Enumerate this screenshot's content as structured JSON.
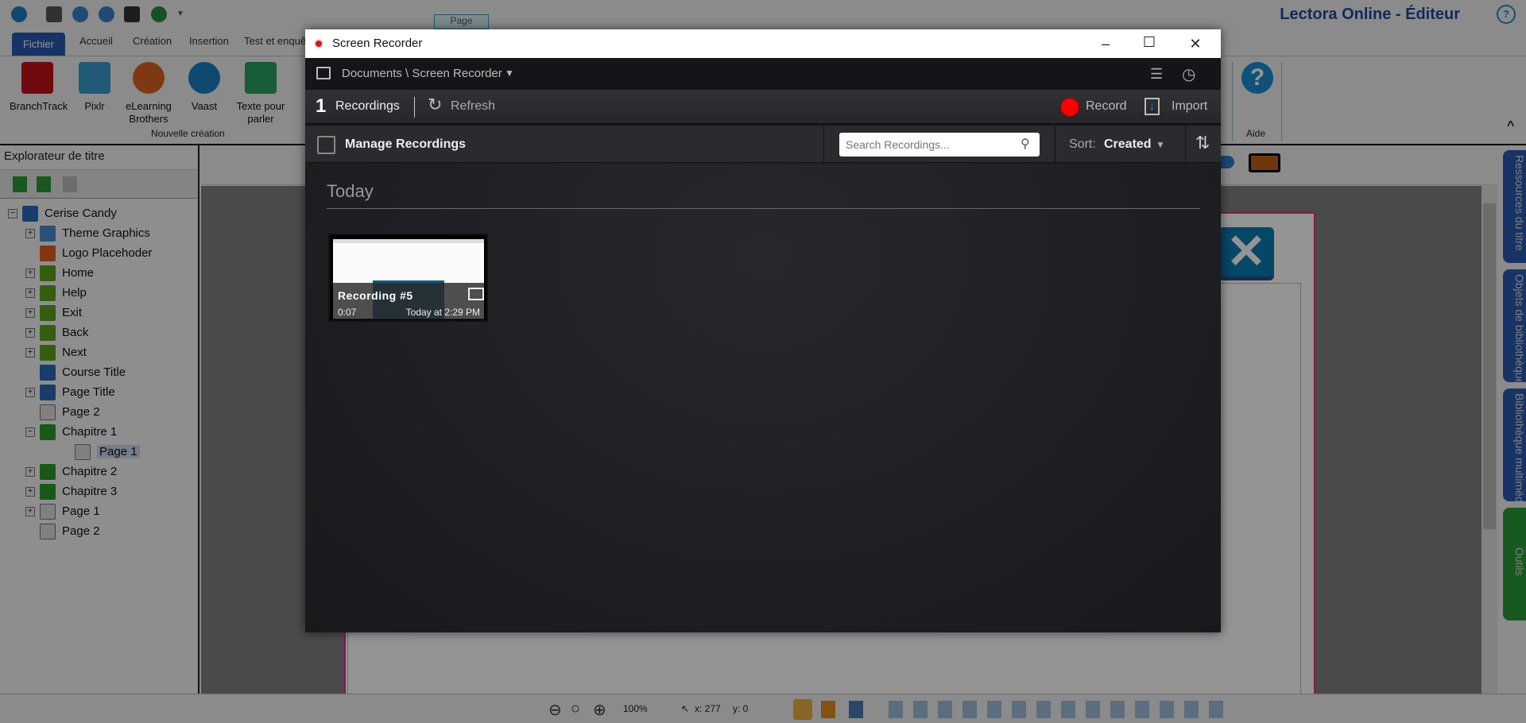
{
  "app": {
    "title": "Lectora Online - Éditeur",
    "page_button": "Page",
    "tabs": [
      "Fichier",
      "Accueil",
      "Création",
      "Insertion",
      "Test et enquê"
    ],
    "ribbon": {
      "items": [
        "BranchTrack",
        "Pixlr",
        "eLearning Brothers",
        "Vaast",
        "Texte pour parler"
      ],
      "group": "Nouvelle création",
      "help_group": "Aide"
    },
    "explorer": {
      "title": "Explorateur de titre",
      "tree": [
        {
          "label": "Cerise Candy",
          "icon": "book-icon",
          "level": 0,
          "exp": "-"
        },
        {
          "label": "Theme Graphics",
          "icon": "group-icon",
          "level": 1,
          "exp": "+"
        },
        {
          "label": "Logo Placehoder",
          "icon": "image-icon",
          "level": 1,
          "exp": ""
        },
        {
          "label": "Home",
          "icon": "button-icon",
          "level": 1,
          "exp": "+"
        },
        {
          "label": "Help",
          "icon": "button-icon",
          "level": 1,
          "exp": "+"
        },
        {
          "label": "Exit",
          "icon": "button-icon",
          "level": 1,
          "exp": "+"
        },
        {
          "label": "Back",
          "icon": "button-icon",
          "level": 1,
          "exp": "+"
        },
        {
          "label": "Next",
          "icon": "button-icon",
          "level": 1,
          "exp": "+"
        },
        {
          "label": "Course Title",
          "icon": "text-icon",
          "level": 1,
          "exp": ""
        },
        {
          "label": "Page Title",
          "icon": "text-icon",
          "level": 1,
          "exp": "+"
        },
        {
          "label": "Page 2",
          "icon": "page-icon",
          "level": 1,
          "exp": ""
        },
        {
          "label": "Chapitre 1",
          "icon": "chapter-icon",
          "level": 1,
          "exp": "-"
        },
        {
          "label": "Page 1",
          "icon": "page-icon",
          "level": 2,
          "exp": "",
          "selected": true
        },
        {
          "label": "Chapitre 2",
          "icon": "chapter-icon",
          "level": 1,
          "exp": "+"
        },
        {
          "label": "Chapitre 3",
          "icon": "chapter-icon",
          "level": 1,
          "exp": "+"
        },
        {
          "label": "Page 1",
          "icon": "page-icon",
          "level": 1,
          "exp": "+"
        },
        {
          "label": "Page 2",
          "icon": "page-icon",
          "level": 1,
          "exp": ""
        }
      ]
    },
    "side_tabs": [
      "Ressources du titre",
      "Objets de bibliothèque",
      "Bibliothèque multimédia",
      "Outils"
    ],
    "status": {
      "zoom": "100%",
      "x": "x: 277",
      "y": "y: 0"
    }
  },
  "recorder": {
    "title": "Screen Recorder",
    "breadcrumb": "Documents \\ Screen Recorder",
    "count": "1",
    "recordings_label": "Recordings",
    "refresh": "Refresh",
    "record": "Record",
    "import": "Import",
    "manage": "Manage Recordings",
    "search_placeholder": "Search Recordings...",
    "sort_label": "Sort:",
    "sort_value": "Created",
    "section": "Today",
    "cards": [
      {
        "title": "Recording #5",
        "duration": "0:07",
        "date": "Today at 2:29 PM"
      }
    ],
    "colors": {
      "record": "#ff0000",
      "bg": "#1d1e21"
    }
  }
}
